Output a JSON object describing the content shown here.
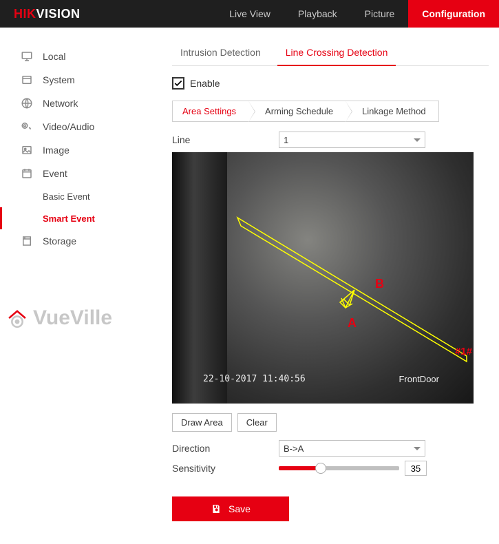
{
  "brand": {
    "hik": "HIK",
    "vision": "VISION"
  },
  "topnav": {
    "live_view": "Live View",
    "playback": "Playback",
    "picture": "Picture",
    "configuration": "Configuration"
  },
  "sidebar": {
    "local": "Local",
    "system": "System",
    "network": "Network",
    "video_audio": "Video/Audio",
    "image": "Image",
    "event": "Event",
    "basic_event": "Basic Event",
    "smart_event": "Smart Event",
    "storage": "Storage"
  },
  "watermark": "VueVille",
  "subtabs": {
    "intrusion": "Intrusion Detection",
    "line_crossing": "Line Crossing Detection"
  },
  "enable": {
    "label": "Enable",
    "checked": true
  },
  "chevrons": {
    "area": "Area Settings",
    "arming": "Arming Schedule",
    "linkage": "Linkage Method"
  },
  "line_field": {
    "label": "Line",
    "value": "1"
  },
  "preview": {
    "timestamp": "22-10-2017  11:40:56",
    "camera_name": "FrontDoor",
    "marker_a": "A",
    "marker_b": "B",
    "marker_1": "#1#"
  },
  "buttons": {
    "draw_area": "Draw Area",
    "clear": "Clear"
  },
  "direction": {
    "label": "Direction",
    "value": "B->A"
  },
  "sensitivity": {
    "label": "Sensitivity",
    "value": "35",
    "percent": 35
  },
  "save": "Save"
}
